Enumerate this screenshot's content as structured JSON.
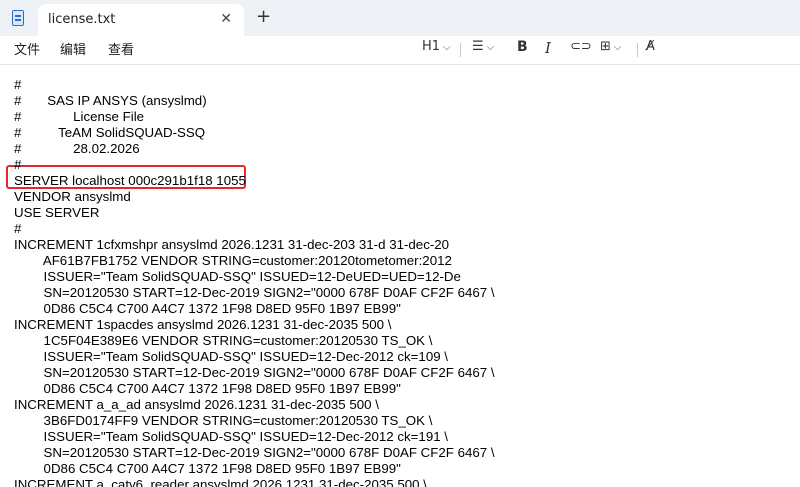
{
  "window": {
    "tab_title": "license.txt",
    "close_glyph": "✕",
    "new_tab_glyph": "+"
  },
  "menu": {
    "file": "文件",
    "edit": "编辑",
    "view": "查看"
  },
  "toolbar": {
    "heading": "H1",
    "list_icon": "☰",
    "bold": "B",
    "italic": "I",
    "link_icon": "⊂⊃",
    "table_icon": "⊞",
    "clear_format_icon": "A̸",
    "chevron": "⌵"
  },
  "document": {
    "lines": [
      "#",
      "#       SAS IP ANSYS (ansyslmd)",
      "#              License File",
      "#          TeAM SolidSQUAD-SSQ",
      "#              28.02.2026",
      "#",
      "SERVER localhost 000c291b1f18 1055",
      "VENDOR ansyslmd",
      "USE SERVER",
      "#",
      "INCREMENT 1cfxmshpr ansyslmd 2026.1231 31-dec-203 31-d 31-dec-20",
      "        AF61B7FB1752 VENDOR STRING=customer:20120tometomer:2012",
      "        ISSUER=\"Team SolidSQUAD-SSQ\" ISSUED=12-DeUED=UED=12-De",
      "        SN=20120530 START=12-Dec-2019 SIGN2=\"0000 678F D0AF CF2F 6467 \\",
      "        0D86 C5C4 C700 A4C7 1372 1F98 D8ED 95F0 1B97 EB99\"",
      "INCREMENT 1spacdes ansyslmd 2026.1231 31-dec-2035 500 \\",
      "        1C5F04E389E6 VENDOR STRING=customer:20120530 TS_OK \\",
      "        ISSUER=\"Team SolidSQUAD-SSQ\" ISSUED=12-Dec-2012 ck=109 \\",
      "        SN=20120530 START=12-Dec-2019 SIGN2=\"0000 678F D0AF CF2F 6467 \\",
      "        0D86 C5C4 C700 A4C7 1372 1F98 D8ED 95F0 1B97 EB99\"",
      "INCREMENT a_a_ad ansyslmd 2026.1231 31-dec-2035 500 \\",
      "        3B6FD0174FF9 VENDOR STRING=customer:20120530 TS_OK \\",
      "        ISSUER=\"Team SolidSQUAD-SSQ\" ISSUED=12-Dec-2012 ck=191 \\",
      "        SN=20120530 START=12-Dec-2019 SIGN2=\"0000 678F D0AF CF2F 6467 \\",
      "        0D86 C5C4 C700 A4C7 1372 1F98 D8ED 95F0 1B97 EB99\"",
      "INCREMENT a_caty6_reader ansyslmd 2026.1231 31-dec-2035 500 \\"
    ]
  },
  "colors": {
    "highlight_border": "#e5262b",
    "titlebar_bg": "#eef1f5"
  }
}
